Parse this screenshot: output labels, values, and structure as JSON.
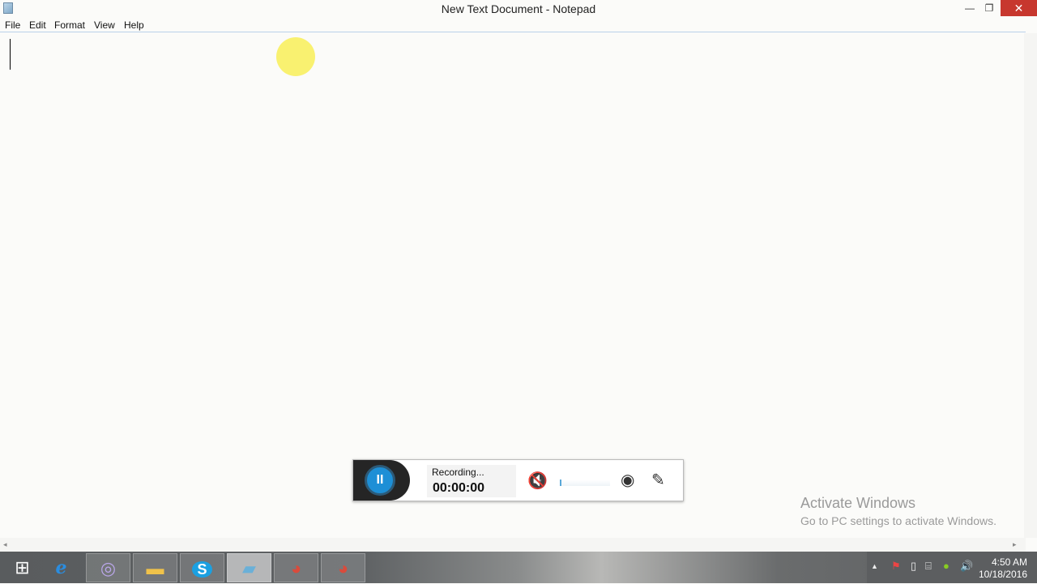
{
  "window": {
    "title": "New Text Document - Notepad",
    "minimize": "—",
    "restore": "❐",
    "close": "✕"
  },
  "menu": [
    "File",
    "Edit",
    "Format",
    "View",
    "Help"
  ],
  "recorder": {
    "status": "Recording...",
    "time": "00:00:00",
    "pause_icon": "II",
    "audio_level": 0.03
  },
  "watermark": {
    "line1": "Activate Windows",
    "line2": "Go to PC settings to activate Windows."
  },
  "scroll": {
    "left": "◂",
    "right": "▸"
  },
  "taskbar": {
    "apps": [
      "start",
      "internet-explorer",
      "bittorrent",
      "file-explorer",
      "skype",
      "notepad",
      "chrome",
      "chrome-profile"
    ]
  },
  "tray": {
    "time": "4:50 AM",
    "date": "10/18/2016"
  }
}
